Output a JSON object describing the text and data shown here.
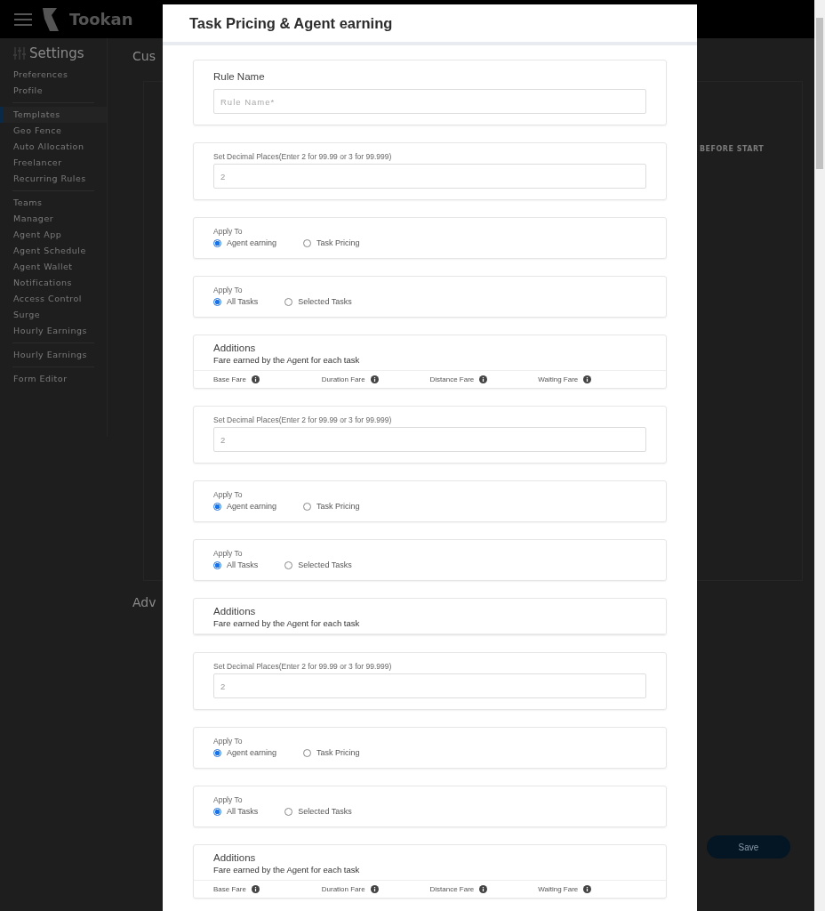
{
  "topbar": {
    "logo": "Tookan"
  },
  "sidebar": {
    "title": "Settings",
    "groups": [
      [
        {
          "label": "Preferences",
          "selected": false
        },
        {
          "label": "Profile",
          "selected": false
        }
      ],
      [
        {
          "label": "Templates",
          "selected": true
        },
        {
          "label": "Geo Fence",
          "selected": false
        },
        {
          "label": "Auto Allocation",
          "selected": false
        },
        {
          "label": "Freelancer",
          "selected": false
        },
        {
          "label": "Recurring Rules",
          "selected": false
        }
      ],
      [
        {
          "label": "Teams",
          "selected": false
        },
        {
          "label": "Manager",
          "selected": false
        },
        {
          "label": "Agent  App",
          "selected": false
        },
        {
          "label": "Agent Schedule",
          "selected": false
        },
        {
          "label": "Agent Wallet",
          "selected": false
        },
        {
          "label": "Notifications",
          "selected": false
        },
        {
          "label": "Access Control",
          "selected": false
        },
        {
          "label": "Surge",
          "selected": false
        },
        {
          "label": "Hourly Earnings",
          "selected": false
        }
      ],
      [
        {
          "label": "Hourly Earnings",
          "selected": false
        }
      ],
      [
        {
          "label": "Form Editor",
          "selected": false
        }
      ]
    ]
  },
  "background": {
    "section_1": "Cus",
    "column_header": "BEFORE START",
    "section_2": "Adv",
    "save_button": "Save"
  },
  "modal": {
    "title": "Task Pricing & Agent earning",
    "blocks": [
      {
        "rule_name": {
          "label": "Rule Name",
          "placeholder": "Rule Name*"
        },
        "decimal": {
          "label": "Set Decimal Places(Enter 2 for 99.99 or 3 for 99.999)",
          "value": "2"
        },
        "apply_to": [
          {
            "label": "Apply To",
            "options": [
              {
                "label": "Agent earning",
                "selected": true
              },
              {
                "label": "Task Pricing",
                "selected": false
              }
            ]
          },
          {
            "label": "Apply To",
            "options": [
              {
                "label": "All Tasks",
                "selected": true
              },
              {
                "label": "Selected Tasks",
                "selected": false
              }
            ]
          }
        ],
        "additions": {
          "title": "Additions",
          "subtitle": "Fare earned by the Agent for each task",
          "fare_columns": [
            "Base Fare",
            "Duration Fare",
            "Distance Fare",
            "Waiting Fare"
          ]
        }
      },
      {
        "decimal": {
          "label": "Set Decimal Places(Enter 2 for 99.99 or 3 for 99.999)",
          "value": "2"
        },
        "apply_to": [
          {
            "label": "Apply To",
            "options": [
              {
                "label": "Agent earning",
                "selected": true
              },
              {
                "label": "Task Pricing",
                "selected": false
              }
            ]
          },
          {
            "label": "Apply To",
            "options": [
              {
                "label": "All Tasks",
                "selected": true
              },
              {
                "label": "Selected Tasks",
                "selected": false
              }
            ]
          }
        ],
        "additions": {
          "title": "Additions",
          "subtitle": "Fare earned by the Agent for each task"
        }
      },
      {
        "decimal": {
          "label": "Set Decimal Places(Enter 2 for 99.99 or 3 for 99.999)",
          "value": "2"
        },
        "apply_to": [
          {
            "label": "Apply To",
            "options": [
              {
                "label": "Agent earning",
                "selected": true
              },
              {
                "label": "Task Pricing",
                "selected": false
              }
            ]
          },
          {
            "label": "Apply To",
            "options": [
              {
                "label": "All Tasks",
                "selected": true
              },
              {
                "label": "Selected Tasks",
                "selected": false
              }
            ]
          }
        ],
        "additions": {
          "title": "Additions",
          "subtitle": "Fare earned by the Agent for each task",
          "fare_columns": [
            "Base Fare",
            "Duration Fare",
            "Distance Fare",
            "Waiting Fare"
          ]
        }
      }
    ]
  }
}
